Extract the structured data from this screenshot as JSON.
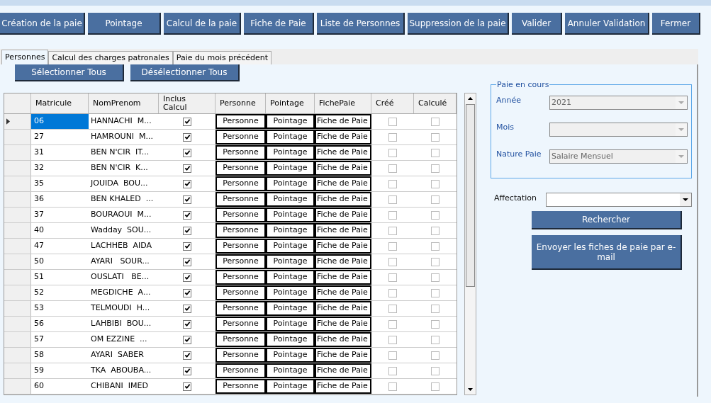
{
  "toolbar": [
    "Création de la paie",
    "Pointage",
    "Calcul de la paie",
    "Fiche de Paie",
    "Liste de Personnes",
    "Suppression de la paie",
    "Valider",
    "Annuler Validation",
    "Fermer"
  ],
  "tabs": [
    {
      "label": "Personnes",
      "selected": true
    },
    {
      "label": "Calcul des charges patronales",
      "selected": false
    },
    {
      "label": "Paie du mois précédent",
      "selected": false
    }
  ],
  "select_buttons": [
    "Sélectionner Tous",
    "Désélectionner Tous"
  ],
  "table": {
    "columns": [
      "Matricule",
      "NomPrenom",
      "Inclus Calcul",
      "Personne",
      "Pointage",
      "FichePaie",
      "Créé",
      "Calculé"
    ],
    "rows": [
      {
        "matricule": "06",
        "nom": "HANNACHI  M...",
        "inclus": true,
        "personne": "Personne",
        "pointage": "Pointage",
        "fiche": "Fiche de Paie",
        "cree": false,
        "calcule": false,
        "selected": true
      },
      {
        "matricule": "27",
        "nom": "HAMROUNI  M...",
        "inclus": true,
        "personne": "Personne",
        "pointage": "Pointage",
        "fiche": "Fiche de Paie",
        "cree": false,
        "calcule": false,
        "selected": false
      },
      {
        "matricule": "31",
        "nom": "BEN N'CIR  IT...",
        "inclus": true,
        "personne": "Personne",
        "pointage": "Pointage",
        "fiche": "Fiche de Paie",
        "cree": false,
        "calcule": false,
        "selected": false
      },
      {
        "matricule": "32",
        "nom": "BEN N'CIR  K...",
        "inclus": true,
        "personne": "Personne",
        "pointage": "Pointage",
        "fiche": "Fiche de Paie",
        "cree": false,
        "calcule": false,
        "selected": false
      },
      {
        "matricule": "35",
        "nom": "JOUIDA  BOU...",
        "inclus": true,
        "personne": "Personne",
        "pointage": "Pointage",
        "fiche": "Fiche de Paie",
        "cree": false,
        "calcule": false,
        "selected": false
      },
      {
        "matricule": "36",
        "nom": "BEN KHALED  ...",
        "inclus": true,
        "personne": "Personne",
        "pointage": "Pointage",
        "fiche": "Fiche de Paie",
        "cree": false,
        "calcule": false,
        "selected": false
      },
      {
        "matricule": "37",
        "nom": "BOURAOUI  M...",
        "inclus": true,
        "personne": "Personne",
        "pointage": "Pointage",
        "fiche": "Fiche de Paie",
        "cree": false,
        "calcule": false,
        "selected": false
      },
      {
        "matricule": "40",
        "nom": "Wadday  SOU...",
        "inclus": true,
        "personne": "Personne",
        "pointage": "Pointage",
        "fiche": "Fiche de Paie",
        "cree": false,
        "calcule": false,
        "selected": false
      },
      {
        "matricule": "47",
        "nom": "LACHHEB  AIDA",
        "inclus": true,
        "personne": "Personne",
        "pointage": "Pointage",
        "fiche": "Fiche de Paie",
        "cree": false,
        "calcule": false,
        "selected": false
      },
      {
        "matricule": "50",
        "nom": "AYARI   SOUR...",
        "inclus": true,
        "personne": "Personne",
        "pointage": "Pointage",
        "fiche": "Fiche de Paie",
        "cree": false,
        "calcule": false,
        "selected": false
      },
      {
        "matricule": "51",
        "nom": "OUSLATI   BE...",
        "inclus": true,
        "personne": "Personne",
        "pointage": "Pointage",
        "fiche": "Fiche de Paie",
        "cree": false,
        "calcule": false,
        "selected": false
      },
      {
        "matricule": "52",
        "nom": "MEGDICHE  A...",
        "inclus": true,
        "personne": "Personne",
        "pointage": "Pointage",
        "fiche": "Fiche de Paie",
        "cree": false,
        "calcule": false,
        "selected": false
      },
      {
        "matricule": "53",
        "nom": "TELMOUDI  H...",
        "inclus": true,
        "personne": "Personne",
        "pointage": "Pointage",
        "fiche": "Fiche de Paie",
        "cree": false,
        "calcule": false,
        "selected": false
      },
      {
        "matricule": "56",
        "nom": "LAHBIBI  BOU...",
        "inclus": true,
        "personne": "Personne",
        "pointage": "Pointage",
        "fiche": "Fiche de Paie",
        "cree": false,
        "calcule": false,
        "selected": false
      },
      {
        "matricule": "57",
        "nom": "OM EZZINE  ...",
        "inclus": true,
        "personne": "Personne",
        "pointage": "Pointage",
        "fiche": "Fiche de Paie",
        "cree": false,
        "calcule": false,
        "selected": false
      },
      {
        "matricule": "58",
        "nom": "AYARI  SABER",
        "inclus": true,
        "personne": "Personne",
        "pointage": "Pointage",
        "fiche": "Fiche de Paie",
        "cree": false,
        "calcule": false,
        "selected": false
      },
      {
        "matricule": "59",
        "nom": "TKA  ABOUBA...",
        "inclus": true,
        "personne": "Personne",
        "pointage": "Pointage",
        "fiche": "Fiche de Paie",
        "cree": false,
        "calcule": false,
        "selected": false
      },
      {
        "matricule": "60",
        "nom": "CHIBANI  IMED",
        "inclus": true,
        "personne": "Personne",
        "pointage": "Pointage",
        "fiche": "Fiche de Paie",
        "cree": false,
        "calcule": false,
        "selected": false
      }
    ]
  },
  "paie_en_cours": {
    "legend": "Paie en cours",
    "fields": [
      {
        "label": "Année",
        "value": "2021",
        "disabled": true
      },
      {
        "label": "Mois",
        "disabled": true
      },
      {
        "label": "Nature Paie",
        "value": "Salaire Mensuel",
        "disabled": true
      }
    ]
  },
  "affectation": {
    "label": "Affectation"
  },
  "actions": [
    "Rechercher",
    "Envoyer les fiches de paie par e-mail"
  ]
}
